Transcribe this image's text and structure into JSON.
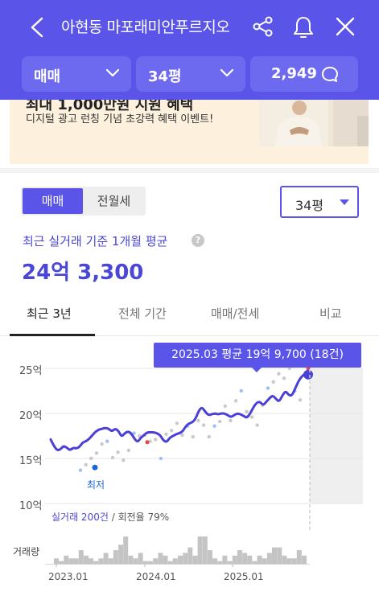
{
  "header": {
    "title": "아현동 마포래미안푸르지오",
    "filters": {
      "trade_type": "매매",
      "size": "34평",
      "count": "2,949"
    }
  },
  "banner": {
    "headline": "최대 1,000만원 지원 혜택",
    "subtitle": "디지털 광고 런칭 기념 초강력 혜택 이벤트!"
  },
  "toggle": {
    "sale": "매매",
    "rent": "전월세"
  },
  "size_select": "34평",
  "summary": {
    "label": "최근 실거래 기준 1개월 평균",
    "help": "?",
    "price": "24억 3,300"
  },
  "tabs": [
    "최근 3년",
    "전체 기간",
    "매매/전세",
    "비교"
  ],
  "chart": {
    "tooltip": "2025.03 평균 19억 9,700 (18건)",
    "min_label": "최저",
    "deal_count": "실거래 200건",
    "turnover": "/ 회전율 79%",
    "volume_label": "거래량"
  },
  "chart_data": {
    "type": "line",
    "ylim": [
      10,
      25
    ],
    "y_ticks": [
      "25억",
      "20억",
      "15억",
      "10억"
    ],
    "x_ticks": [
      "2023.01",
      "2024.01",
      "2025.01"
    ],
    "series": [
      {
        "values": [
          17.1,
          16.4,
          15.9,
          16.0,
          16.4,
          16.2,
          15.9,
          16.2,
          16.1,
          16.3,
          16.8,
          16.9,
          17.2,
          17.6,
          18.0,
          18.2,
          18.3,
          18.4,
          18.3,
          18.0,
          18.3,
          18.1,
          17.4,
          17.8,
          18.0,
          17.8,
          17.2,
          16.8,
          17.3,
          17.6,
          17.9,
          17.9,
          17.9,
          17.8,
          17.6,
          17.0,
          16.8,
          17.3,
          17.5,
          17.7,
          17.8,
          18.0,
          18.6,
          18.9,
          19.0,
          19.4,
          20.3,
          20.7,
          20.2,
          19.8,
          19.9,
          20.0,
          19.9,
          20.0,
          20.0,
          19.8,
          19.6,
          19.8,
          20.0,
          19.9,
          19.7,
          19.5,
          20.0,
          20.7,
          21.2,
          21.3,
          20.9,
          21.3,
          21.7,
          22.0,
          21.6,
          21.3,
          22.0,
          22.5,
          22.0,
          22.0,
          22.8,
          23.6,
          24.1,
          24.4,
          24.3
        ]
      }
    ],
    "minimum": {
      "value": 14.0
    },
    "volume": [
      2,
      1,
      3,
      2,
      2,
      5,
      3,
      2,
      1,
      2,
      4,
      2,
      5,
      7,
      10,
      3,
      2,
      4,
      1,
      1,
      2,
      4,
      3,
      1,
      2,
      3,
      4,
      6,
      3,
      10,
      10,
      5,
      2,
      1,
      3,
      1,
      3,
      5,
      4,
      3,
      1,
      3,
      2,
      4,
      6,
      6,
      3,
      2,
      2,
      5,
      3
    ],
    "outliers": [
      {
        "value": 13.7
      },
      {
        "value": 14.3
      },
      {
        "value": 15.0
      },
      {
        "value": 15.6
      },
      {
        "value": 16.6
      },
      {
        "value": 16.9
      },
      {
        "value": 15.1
      },
      {
        "value": 15.7
      },
      {
        "value": 14.8
      },
      {
        "value": 15.9
      },
      {
        "value": 17.8
      },
      {
        "value": 17.5
      },
      {
        "value": 17.6
      },
      {
        "value": 16.9
      },
      {
        "value": 17.1
      },
      {
        "value": 15.0
      },
      {
        "value": 17.7
      },
      {
        "value": 18.1
      },
      {
        "value": 18.9
      },
      {
        "value": 17.6
      },
      {
        "value": 18.6
      },
      {
        "value": 17.4
      },
      {
        "value": 19.2
      },
      {
        "value": 18.7
      },
      {
        "value": 17.4
      },
      {
        "value": 18.6
      },
      {
        "value": 19.1
      },
      {
        "value": 20.8
      },
      {
        "value": 19.2
      },
      {
        "value": 21.4
      },
      {
        "value": 22.5
      },
      {
        "value": 20.2
      },
      {
        "value": 19.6
      },
      {
        "value": 18.7
      },
      {
        "value": 20.9
      },
      {
        "value": 22.8
      },
      {
        "value": 23.5
      },
      {
        "value": 24.4
      },
      {
        "value": 23.9
      },
      {
        "value": 25.0
      },
      {
        "value": 22.5
      },
      {
        "value": 21.5
      }
    ]
  }
}
